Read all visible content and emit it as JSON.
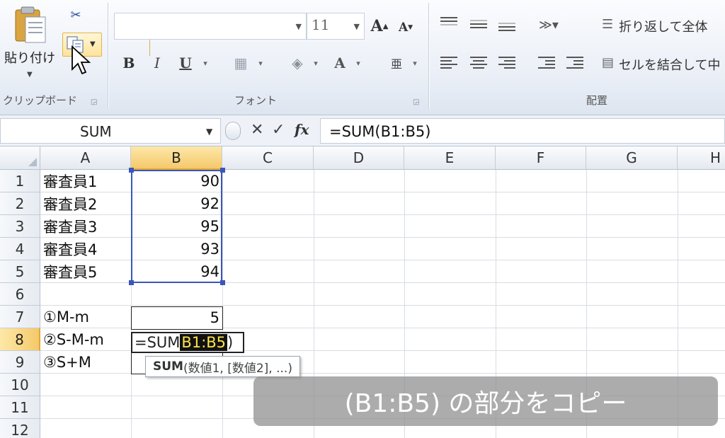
{
  "ribbon": {
    "clipboard": {
      "paste_label": "貼り付け",
      "group_label": "クリップボード",
      "launcher": "⌞"
    },
    "font": {
      "font_name": "",
      "font_size": "11",
      "grow_label": "A",
      "shrink_label": "A",
      "bold": "B",
      "italic": "I",
      "underline": "U",
      "font_color_label": "A",
      "group_label": "フォント"
    },
    "alignment": {
      "wrap_text_label": "折り返して全体",
      "merge_label": "セルを結合して中",
      "group_label": "配置"
    }
  },
  "formula_bar": {
    "name_box": "SUM",
    "cancel": "✕",
    "enter": "✓",
    "fx": "fx",
    "formula": "=SUM(B1:B5)"
  },
  "grid": {
    "columns": [
      "A",
      "B",
      "C",
      "D",
      "E",
      "F",
      "G",
      "H"
    ],
    "rows": [
      "1",
      "2",
      "3",
      "4",
      "5",
      "6",
      "7",
      "8",
      "9",
      "10",
      "11",
      "12"
    ],
    "cells": {
      "A1": "審査員1",
      "A2": "審査員2",
      "A3": "審査員3",
      "A4": "審査員4",
      "A5": "審査員5",
      "B1": "90",
      "B2": "92",
      "B3": "95",
      "B4": "93",
      "B5": "94",
      "A7": "①M-m",
      "B7": "5",
      "A8": "②S-M-m",
      "A9": "③S+M"
    },
    "editing": {
      "prefix": "=SUM",
      "highlighted": "B1:B5",
      "suffix": ")"
    },
    "tooltip": {
      "func": "SUM",
      "args": "(数値1, [数値2], ...)"
    }
  },
  "caption": "(B1:B5) の部分をコピー",
  "colors": {
    "selection": "#3a56b8",
    "active_header": "#f5c96a"
  }
}
